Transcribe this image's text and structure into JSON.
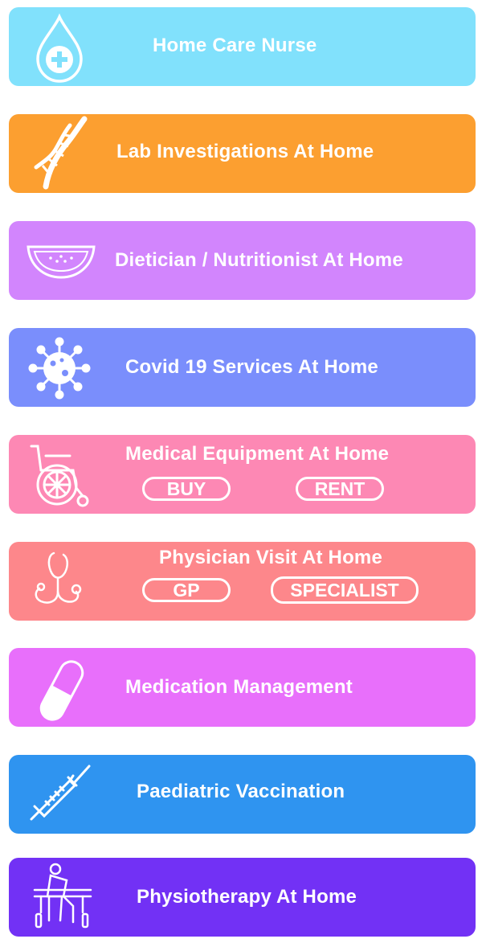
{
  "services": [
    {
      "title": "Home Care Nurse",
      "color": "#81E1FC",
      "icon": "blood-drop-plus-icon"
    },
    {
      "title": "Lab Investigations At Home",
      "color": "#FC9F30",
      "icon": "dna-icon"
    },
    {
      "title": "Dietician / Nutritionist At Home",
      "color": "#D285FD",
      "icon": "watermelon-icon"
    },
    {
      "title": "Covid 19 Services At Home",
      "color": "#7A8EFC",
      "icon": "virus-icon"
    },
    {
      "title": "Medical Equipment At Home",
      "color": "#FD88B4",
      "icon": "wheelchair-icon",
      "options": [
        "BUY",
        "RENT"
      ]
    },
    {
      "title": "Physician Visit At Home",
      "color": "#FD878B",
      "icon": "stethoscope-icon",
      "options": [
        "GP",
        "SPECIALIST"
      ]
    },
    {
      "title": "Medication Management",
      "color": "#E86FFB",
      "icon": "capsule-icon"
    },
    {
      "title": "Paediatric Vaccination",
      "color": "#2F94F0",
      "icon": "syringe-icon"
    },
    {
      "title": "Physiotherapy At Home",
      "color": "#7231F5",
      "icon": "physiotherapy-icon"
    }
  ]
}
